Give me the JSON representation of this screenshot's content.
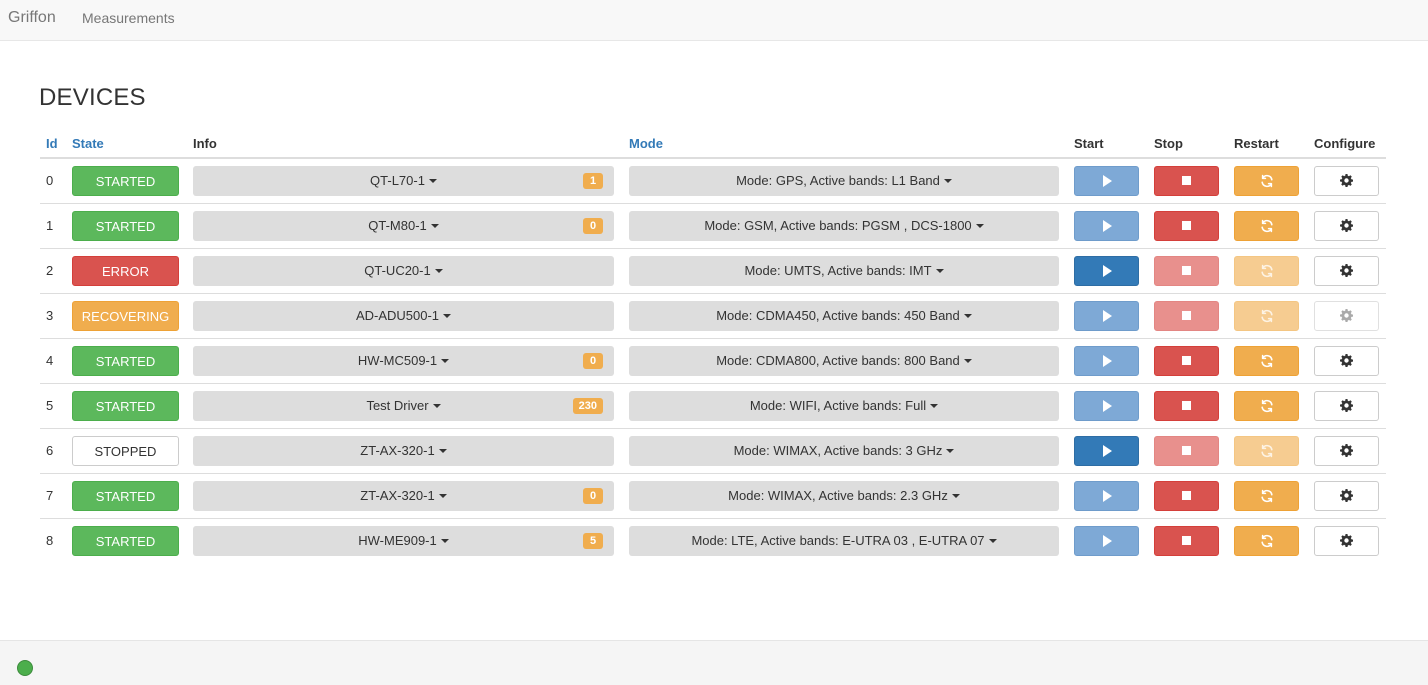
{
  "navbar": {
    "brand": "Griffon",
    "links": [
      "Measurements"
    ]
  },
  "page": {
    "title": "DEVICES"
  },
  "table": {
    "headers": {
      "id": "Id",
      "state": "State",
      "info": "Info",
      "mode": "Mode",
      "start": "Start",
      "stop": "Stop",
      "restart": "Restart",
      "configure": "Configure"
    },
    "rows": [
      {
        "id": "0",
        "state": "STARTED",
        "state_kind": "started",
        "info": "QT-L70-1",
        "badge": "1",
        "mode": "Mode: GPS, Active bands: L1 Band",
        "start_enabled": false,
        "stop_enabled": true,
        "restart_enabled": true,
        "configure_enabled": true
      },
      {
        "id": "1",
        "state": "STARTED",
        "state_kind": "started",
        "info": "QT-M80-1",
        "badge": "0",
        "mode": "Mode: GSM, Active bands: PGSM , DCS-1800",
        "start_enabled": false,
        "stop_enabled": true,
        "restart_enabled": true,
        "configure_enabled": true
      },
      {
        "id": "2",
        "state": "ERROR",
        "state_kind": "error",
        "info": "QT-UC20-1",
        "badge": "",
        "mode": "Mode: UMTS, Active bands: IMT",
        "start_enabled": true,
        "stop_enabled": false,
        "restart_enabled": false,
        "configure_enabled": true
      },
      {
        "id": "3",
        "state": "RECOVERING",
        "state_kind": "recovering",
        "info": "AD-ADU500-1",
        "badge": "",
        "mode": "Mode: CDMA450, Active bands: 450 Band",
        "start_enabled": false,
        "stop_enabled": false,
        "restart_enabled": false,
        "configure_enabled": false
      },
      {
        "id": "4",
        "state": "STARTED",
        "state_kind": "started",
        "info": "HW-MC509-1",
        "badge": "0",
        "mode": "Mode: CDMA800, Active bands: 800 Band",
        "start_enabled": false,
        "stop_enabled": true,
        "restart_enabled": true,
        "configure_enabled": true
      },
      {
        "id": "5",
        "state": "STARTED",
        "state_kind": "started",
        "info": "Test Driver",
        "badge": "230",
        "mode": "Mode: WIFI, Active bands: Full",
        "start_enabled": false,
        "stop_enabled": true,
        "restart_enabled": true,
        "configure_enabled": true
      },
      {
        "id": "6",
        "state": "STOPPED",
        "state_kind": "stopped",
        "info": "ZT-AX-320-1",
        "badge": "",
        "mode": "Mode: WIMAX, Active bands: 3 GHz",
        "start_enabled": true,
        "stop_enabled": false,
        "restart_enabled": false,
        "configure_enabled": true
      },
      {
        "id": "7",
        "state": "STARTED",
        "state_kind": "started",
        "info": "ZT-AX-320-1",
        "badge": "0",
        "mode": "Mode: WIMAX, Active bands: 2.3 GHz",
        "start_enabled": false,
        "stop_enabled": true,
        "restart_enabled": true,
        "configure_enabled": true
      },
      {
        "id": "8",
        "state": "STARTED",
        "state_kind": "started",
        "info": "HW-ME909-1",
        "badge": "5",
        "mode": "Mode: LTE, Active bands: E-UTRA 03 , E-UTRA 07",
        "start_enabled": false,
        "stop_enabled": true,
        "restart_enabled": true,
        "configure_enabled": true
      }
    ]
  },
  "icons": {
    "start": "play-icon",
    "stop": "stop-icon",
    "restart": "refresh-icon",
    "configure": "gear-icon",
    "dropdown": "caret-down-icon"
  },
  "colors": {
    "started": "#5cb85c",
    "error": "#d9534f",
    "recovering": "#f0ad4e",
    "primary": "#337ab7",
    "badge": "#f0ad4e"
  },
  "footer": {
    "status_indicator": "online"
  }
}
